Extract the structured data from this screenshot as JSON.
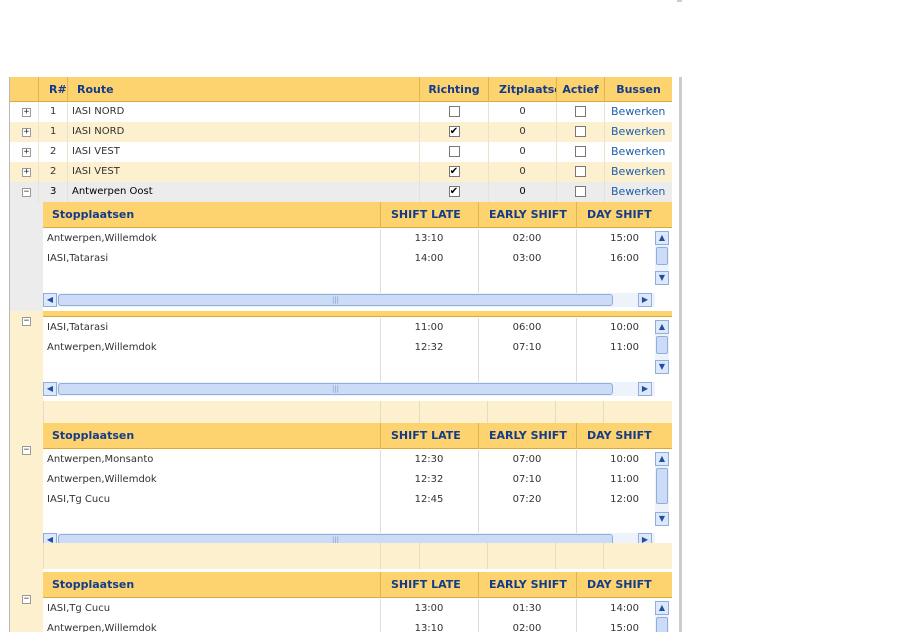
{
  "grid": {
    "columns": {
      "rownum": "R#",
      "route": "Route",
      "richting": "Richting",
      "zitplaatsen": "Zitplaatse",
      "actief": "Actief",
      "bussen": "Bussen"
    },
    "rows": [
      {
        "expander": "+",
        "num": "1",
        "route": "IASI NORD",
        "richting": false,
        "zitplaatsen": "0",
        "actief": false,
        "bussen": "Bewerken"
      },
      {
        "expander": "+",
        "num": "1",
        "route": "IASI NORD",
        "richting": true,
        "zitplaatsen": "0",
        "actief": false,
        "bussen": "Bewerken"
      },
      {
        "expander": "+",
        "num": "2",
        "route": "IASI VEST",
        "richting": false,
        "zitplaatsen": "0",
        "actief": false,
        "bussen": "Bewerken"
      },
      {
        "expander": "+",
        "num": "2",
        "route": "IASI VEST",
        "richting": true,
        "zitplaatsen": "0",
        "actief": false,
        "bussen": "Bewerken"
      },
      {
        "expander": "−",
        "num": "3",
        "route": "Antwerpen Oost",
        "richting": true,
        "zitplaatsen": "0",
        "actief": false,
        "bussen": "Bewerken"
      }
    ]
  },
  "subgrid_columns": {
    "stop": "Stopplaatsen",
    "late": "SHIFT LATE",
    "early": "EARLY SHIFT",
    "day": "DAY SHIFT"
  },
  "subgrids": [
    {
      "show_header": true,
      "expander": "",
      "rows": [
        {
          "stop": "Antwerpen,Willemdok",
          "late": "13:10",
          "early": "02:00",
          "day": "15:00"
        },
        {
          "stop": "IASI,Tatarasi",
          "late": "14:00",
          "early": "03:00",
          "day": "16:00"
        }
      ]
    },
    {
      "show_header": false,
      "expander": "−",
      "rows": [
        {
          "stop": "IASI,Tatarasi",
          "late": "11:00",
          "early": "06:00",
          "day": "10:00"
        },
        {
          "stop": "Antwerpen,Willemdok",
          "late": "12:32",
          "early": "07:10",
          "day": "11:00"
        }
      ]
    },
    {
      "show_header": true,
      "expander": "−",
      "rows": [
        {
          "stop": "Antwerpen,Monsanto",
          "late": "12:30",
          "early": "07:00",
          "day": "10:00"
        },
        {
          "stop": "Antwerpen,Willemdok",
          "late": "12:32",
          "early": "07:10",
          "day": "11:00"
        },
        {
          "stop": "IASI,Tg Cucu",
          "late": "12:45",
          "early": "07:20",
          "day": "12:00"
        }
      ]
    },
    {
      "show_header": true,
      "expander": "−",
      "rows": [
        {
          "stop": "IASI,Tg Cucu",
          "late": "13:00",
          "early": "01:30",
          "day": "14:00"
        },
        {
          "stop": "Antwerpen,Willemdok",
          "late": "13:10",
          "early": "02:00",
          "day": "15:00"
        }
      ]
    }
  ],
  "scroll_glyphs": {
    "up": "▲",
    "down": "▼",
    "left": "◀",
    "right": "▶",
    "grip": "|||"
  },
  "checkbox_mark": "✔",
  "colors": {
    "header": "#fcd36f",
    "header_text": "#143b8a",
    "alt_row": "#fdf0cf",
    "link": "#1d5fa8"
  }
}
